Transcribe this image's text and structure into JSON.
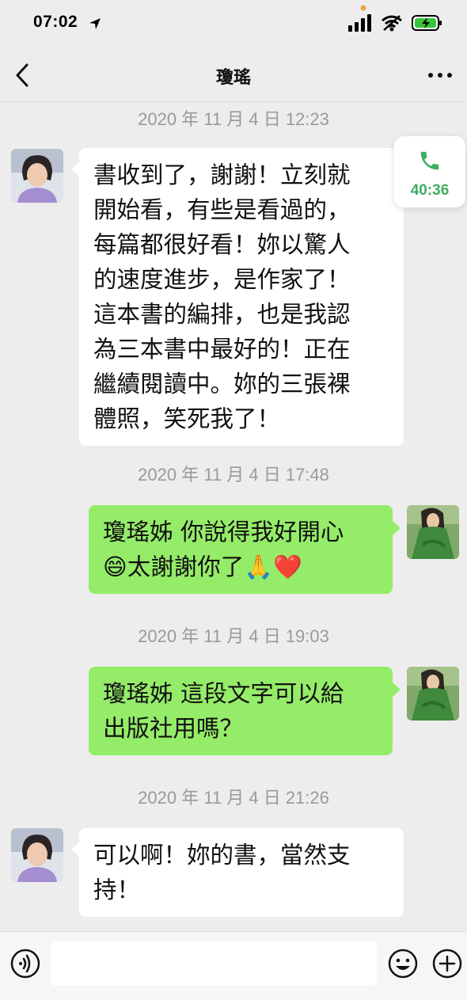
{
  "status_bar": {
    "time": "07:02"
  },
  "header": {
    "title": "瓊瑤"
  },
  "call": {
    "duration": "40:36"
  },
  "messages": [
    {
      "timestamp": "2020 年 11 月 4 日 12:23",
      "direction": "incoming",
      "lines": [
        "書收到了，謝謝！立刻就",
        "開始看，有些是看過的，",
        "每篇都很好看！妳以驚人",
        "的速度進步，是作家了！",
        "這本書的編排，也是我認",
        "為三本書中最好的！正在",
        "繼續閱讀中。妳的三張裸",
        "體照，笑死我了！"
      ]
    },
    {
      "timestamp": "2020 年 11 月 4 日 17:48",
      "direction": "outgoing",
      "lines": [
        "瓊瑤姊 你說得我好開心",
        "太謝謝你了"
      ],
      "emoji": [
        "😄",
        "🙏",
        "❤️"
      ]
    },
    {
      "timestamp": "2020 年 11 月 4 日 19:03",
      "direction": "outgoing",
      "lines": [
        "瓊瑤姊 這段文字可以給",
        "出版社用嗎？"
      ]
    },
    {
      "timestamp": "2020 年 11 月 4 日 21:26",
      "direction": "incoming",
      "lines": [
        "可以啊！妳的書，當然支",
        "持！"
      ]
    }
  ],
  "input": {
    "placeholder": ""
  },
  "icons": {
    "back": "chevron-left-icon",
    "more": "more-dots-icon",
    "phone": "phone-icon",
    "voice": "voice-input-icon",
    "emoji": "emoji-icon",
    "plus": "plus-icon"
  },
  "colors": {
    "outgoing_bubble": "#95ec69",
    "incoming_bubble": "#ffffff",
    "call_green": "#3fae63"
  }
}
